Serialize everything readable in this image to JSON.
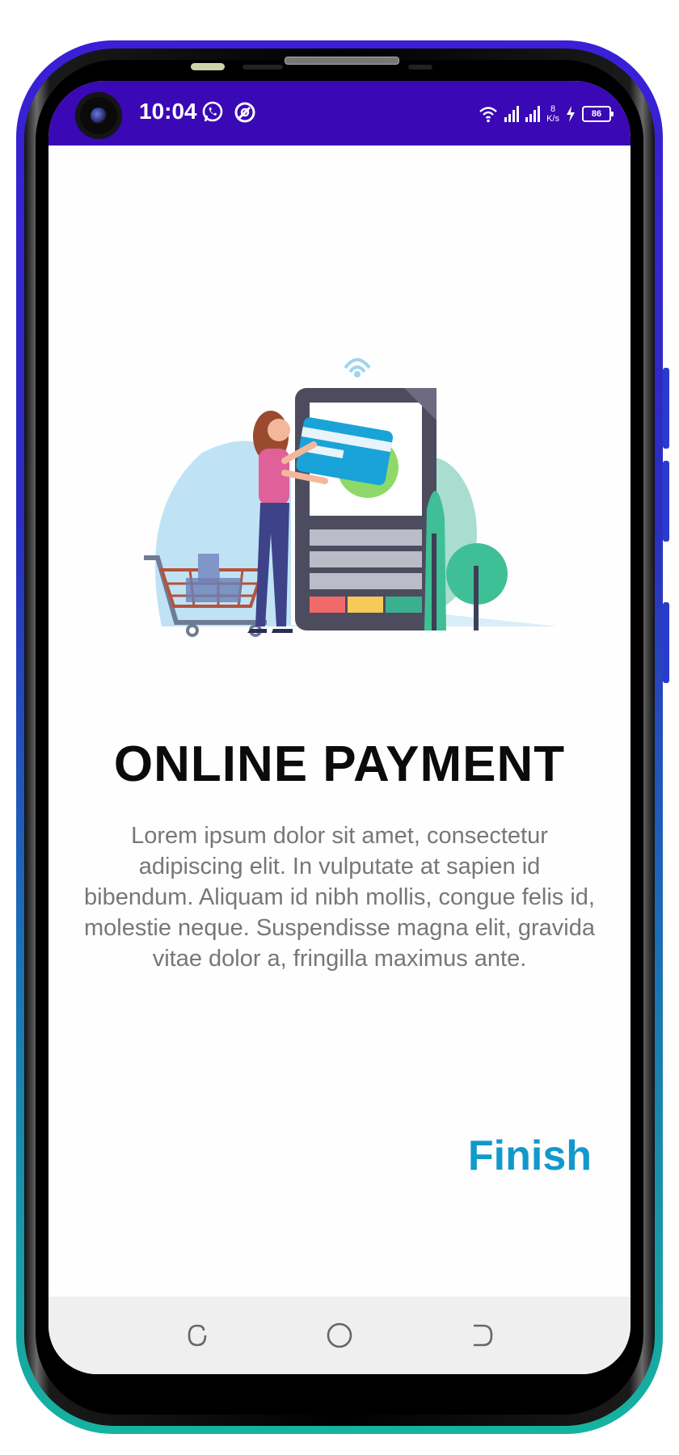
{
  "status_bar": {
    "time": "10:04",
    "net_speed_value": "8",
    "net_speed_unit": "K/s",
    "battery_level": "86",
    "background_color": "#3a08b4"
  },
  "icons": {
    "camera": "front-camera-icon",
    "whatsapp": "whatsapp-icon",
    "notification": "app-notification-icon",
    "wifi": "wifi-icon",
    "signal": "signal-icon",
    "charging": "charging-icon",
    "battery": "battery-icon",
    "recents": "recents-icon",
    "home": "home-icon",
    "back": "back-icon"
  },
  "onboarding": {
    "title": "ONLINE PAYMENT",
    "description": "Lorem ipsum dolor sit amet, consectetur adipiscing elit. In vulputate at sapien id bibendum. Aliquam id nibh mollis, congue felis id, molestie neque. Suspendisse magna elit, gravida vitae dolor a, fringilla maximus ante.",
    "finish_label": "Finish",
    "accent_color": "#1299cc"
  }
}
